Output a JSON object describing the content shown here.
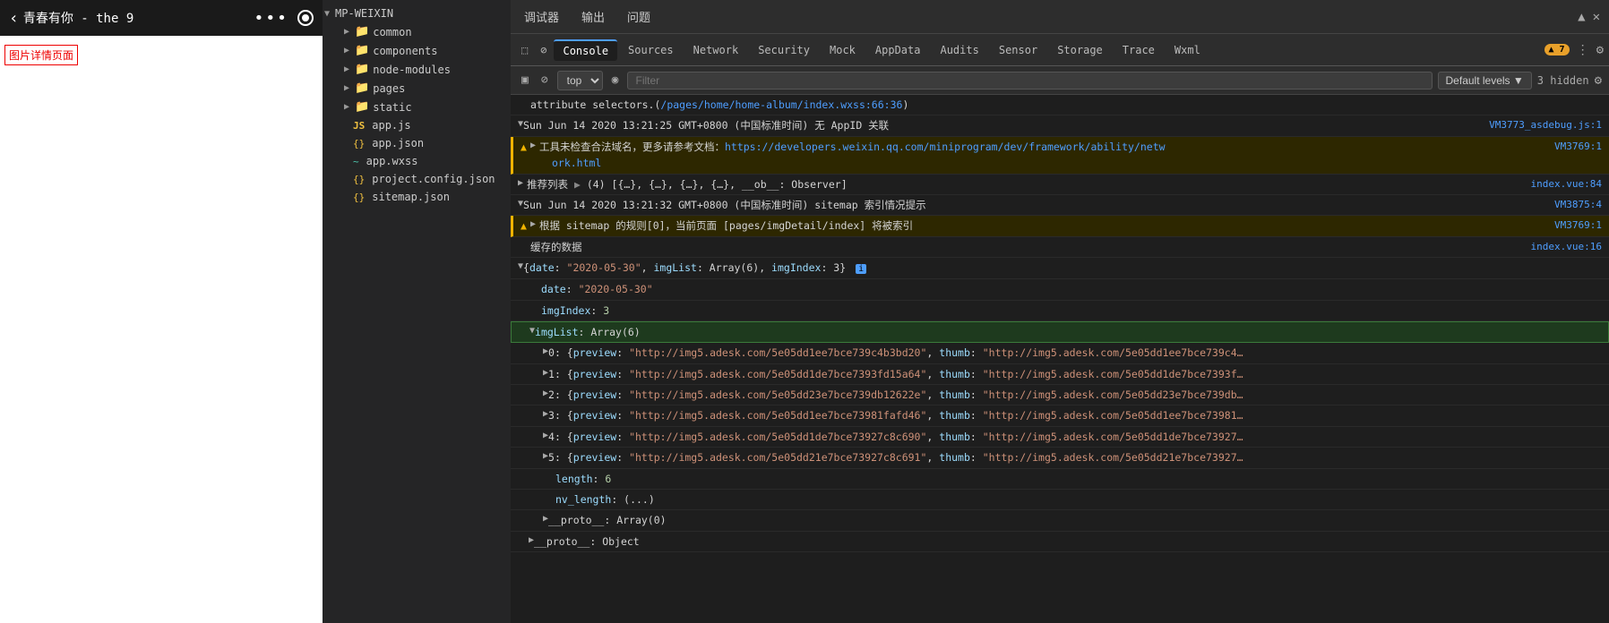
{
  "mobile": {
    "title": "青春有你 - the 9",
    "page_label": "图片详情页面",
    "back_label": "‹"
  },
  "filetree": {
    "root": "MP-WEIXIN",
    "items": [
      {
        "label": "common",
        "type": "folder",
        "color": "blue",
        "indent": 1
      },
      {
        "label": "components",
        "type": "folder",
        "color": "blue",
        "indent": 1
      },
      {
        "label": "node-modules",
        "type": "folder",
        "color": "blue",
        "indent": 1
      },
      {
        "label": "pages",
        "type": "folder",
        "color": "orange",
        "indent": 1
      },
      {
        "label": "static",
        "type": "folder",
        "color": "blue",
        "indent": 1
      },
      {
        "label": "app.js",
        "type": "js",
        "indent": 1
      },
      {
        "label": "app.json",
        "type": "json",
        "indent": 1
      },
      {
        "label": "app.wxss",
        "type": "wxss",
        "indent": 1
      },
      {
        "label": "project.config.json",
        "type": "json",
        "indent": 1
      },
      {
        "label": "sitemap.json",
        "type": "json",
        "indent": 1
      }
    ]
  },
  "devtools": {
    "topbar": {
      "tabs": [
        "调试器",
        "输出",
        "问题"
      ]
    },
    "tabs": [
      "Console",
      "Sources",
      "Network",
      "Security",
      "Mock",
      "AppData",
      "Audits",
      "Sensor",
      "Storage",
      "Trace",
      "Wxml"
    ],
    "active_tab": "Console",
    "warning_badge": "▲ 7",
    "hidden_count": "3 hidden",
    "filter_placeholder": "Filter",
    "levels_label": "Default levels ▼",
    "console_log": [
      {
        "type": "normal",
        "text": "attribute selectors.(/pages/home/home-album/index.wxss:66:36)",
        "source": ""
      },
      {
        "type": "normal",
        "text": "▼ Sun Jun 14 2020 13:21:25 GMT+0800 (中国标准时间) 无 AppID 关联",
        "source": "VM3773_asdebug.js:1",
        "expand": true
      },
      {
        "type": "warning",
        "text": "▲ ▶ 工具未检查合法域名，更多请参考文档：https://developers.weixin.qq.com/miniprogram/dev/framework/ability/netw ork.html",
        "source": "VM3769:1",
        "link": "https://developers.weixin.qq.com/miniprogram/dev/framework/ability/netw ork.html"
      },
      {
        "type": "normal",
        "text": "推荐列表 ▶ (4) [{…}, {…}, {…}, {…}, __ob__: Observer]",
        "source": "index.vue:84"
      },
      {
        "type": "normal",
        "text": "▼ Sun Jun 14 2020 13:21:32 GMT+0800 (中国标准时间) sitemap 索引情况提示",
        "source": "VM3875:4",
        "expand": true
      },
      {
        "type": "warning",
        "text": "▲ ▶ 根据 sitemap 的规则[0]，当前页面 [pages/imgDetail/index] 将被索引",
        "source": "VM3769:1"
      },
      {
        "type": "normal",
        "text": "缓存的数据",
        "source": "index.vue:16"
      },
      {
        "type": "object_expand",
        "text": "▼ {date: \"2020-05-30\", imgList: Array(6), imgIndex: 3}",
        "indent": 0,
        "has_info": true
      },
      {
        "type": "property",
        "text": "date: \"2020-05-30\"",
        "key": "date",
        "val": "\"2020-05-30\"",
        "indent": 1
      },
      {
        "type": "property",
        "text": "imgIndex: 3",
        "key": "imgIndex",
        "val": "3",
        "indent": 1
      },
      {
        "type": "array_expand",
        "text": "▼ imgList: Array(6)",
        "indent": 1,
        "highlighted": true
      },
      {
        "type": "array_item",
        "text": "▶ 0: {preview: \"http://img5.adesk.com/5e05dd1ee7bce739c4b3bd20\", thumb: \"http://img5.adesk.com/5e05dd1ee7bce739c4…",
        "indent": 2
      },
      {
        "type": "array_item",
        "text": "▶ 1: {preview: \"http://img5.adesk.com/5e05dd1de7bce7393fd15a64\", thumb: \"http://img5.adesk.com/5e05dd1de7bce7393f…",
        "indent": 2
      },
      {
        "type": "array_item",
        "text": "▶ 2: {preview: \"http://img5.adesk.com/5e05dd23e7bce739db12622e\", thumb: \"http://img5.adesk.com/5e05dd23e7bce739db…",
        "indent": 2
      },
      {
        "type": "array_item",
        "text": "▶ 3: {preview: \"http://img5.adesk.com/5e05dd1ee7bce73981fafd46\", thumb: \"http://img5.adesk.com/5e05dd1ee7bce73981…",
        "indent": 2
      },
      {
        "type": "array_item",
        "text": "▶ 4: {preview: \"http://img5.adesk.com/5e05dd1de7bce73927c8c690\", thumb: \"http://img5.adesk.com/5e05dd1de7bce73927…",
        "indent": 2
      },
      {
        "type": "array_item",
        "text": "▶ 5: {preview: \"http://img5.adesk.com/5e05dd21e7bce73927c8c691\", thumb: \"http://img5.adesk.com/5e05dd21e7bce73927…",
        "indent": 2
      },
      {
        "type": "property",
        "text": "length: 6",
        "key": "length",
        "val": "6",
        "indent": 2
      },
      {
        "type": "property",
        "text": "nv_length: (...)",
        "key": "nv_length",
        "val": "(...)",
        "indent": 2
      },
      {
        "type": "array_item",
        "text": "▶ __proto__: Array(0)",
        "indent": 2
      },
      {
        "type": "property",
        "text": "▶ __proto__: Object",
        "indent": 1
      }
    ]
  }
}
